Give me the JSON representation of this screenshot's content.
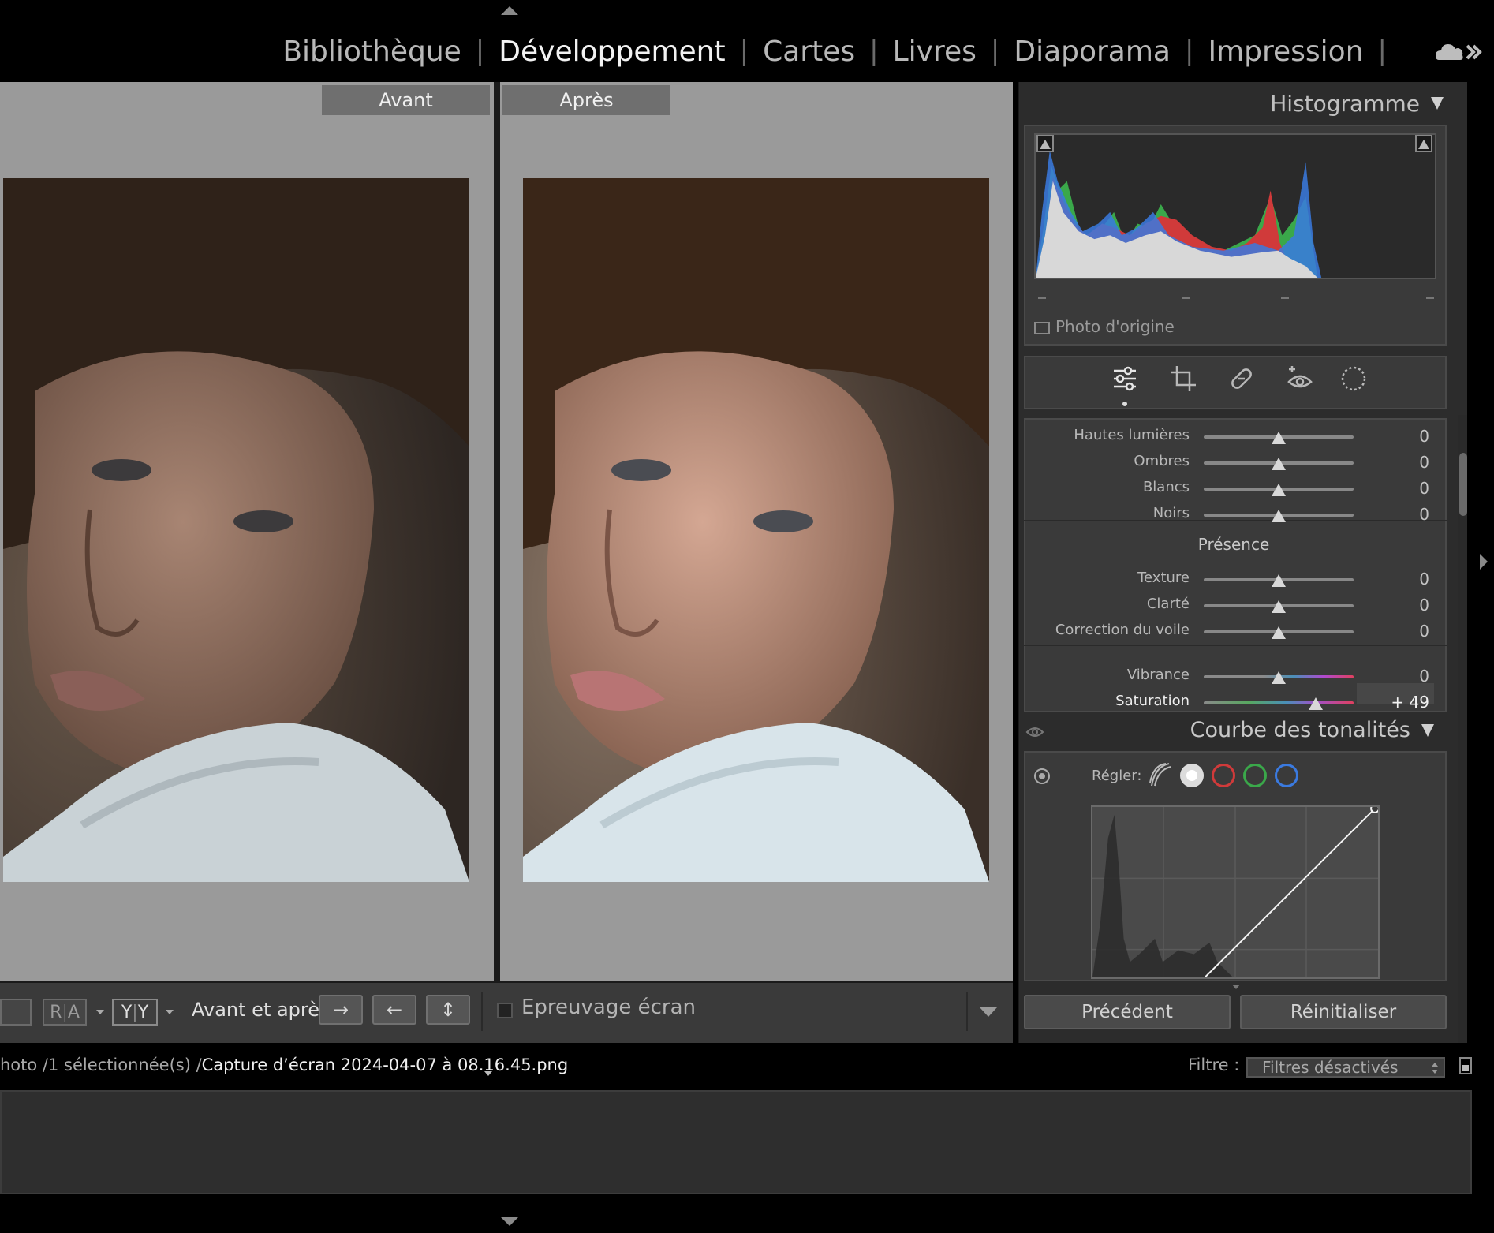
{
  "modules": {
    "items": [
      "Bibliothèque",
      "Développement",
      "Cartes",
      "Livres",
      "Diaporama",
      "Impression"
    ],
    "active": "Développement",
    "separator": "|"
  },
  "compare": {
    "before_label": "Avant",
    "after_label": "Après"
  },
  "toolbar": {
    "view_box_1": "",
    "ra_left": "R",
    "ra_right": "A",
    "yy_left": "Y",
    "yy_right": "Y",
    "before_after_label": "Avant et après :",
    "copy_to_after_glyph": "→",
    "copy_to_before_glyph": "←",
    "swap_glyph": "↕",
    "soft_proof_label": "Epreuvage écran",
    "soft_proof_checked": false
  },
  "histogram": {
    "title": "Histogramme",
    "original_photo_label": "Photo d'origine",
    "tick_marks": [
      "–",
      "–",
      "–",
      "–"
    ]
  },
  "tools": [
    "sliders-icon",
    "crop-icon",
    "healing-icon",
    "redeye-icon",
    "masking-icon"
  ],
  "basic": {
    "rows": [
      {
        "label": "Hautes lumières",
        "value": "0",
        "position": 0.5
      },
      {
        "label": "Ombres",
        "value": "0",
        "position": 0.5
      },
      {
        "label": "Blancs",
        "value": "0",
        "position": 0.5
      },
      {
        "label": "Noirs",
        "value": "0",
        "position": 0.5
      }
    ],
    "presence_title": "Présence",
    "presence_rows": [
      {
        "label": "Texture",
        "value": "0",
        "position": 0.5
      },
      {
        "label": "Clarté",
        "value": "0",
        "position": 0.5
      },
      {
        "label": "Correction du voile",
        "value": "0",
        "position": 0.5
      }
    ],
    "color_rows": [
      {
        "label": "Vibrance",
        "value": "0",
        "position": 0.5
      },
      {
        "label": "Saturation",
        "value": "+ 49",
        "position": 0.745
      }
    ]
  },
  "tone_curve": {
    "title": "Courbe des tonalités",
    "adjust_label": "Régler:",
    "channels": [
      {
        "name": "parametric",
        "color": "#bbbbbb"
      },
      {
        "name": "point-white",
        "color": "#ffffff"
      },
      {
        "name": "red",
        "color": "#d03a3a"
      },
      {
        "name": "green",
        "color": "#3aa84a"
      },
      {
        "name": "blue",
        "color": "#3a7ae0"
      }
    ]
  },
  "panel_buttons": {
    "previous": "Précédent",
    "reset": "Réinitialiser"
  },
  "filmstrip": {
    "path_prefix": "hoto /1 sélectionnée(s) /",
    "filename": "Capture d’écran 2024-04-07 à 08.16.45.png",
    "filter_label": "Filtre :",
    "filter_value": "Filtres désactivés"
  },
  "colors": {
    "accent_red": "#d03a3a",
    "accent_green": "#3aa84a",
    "accent_blue": "#3a7ae0"
  }
}
